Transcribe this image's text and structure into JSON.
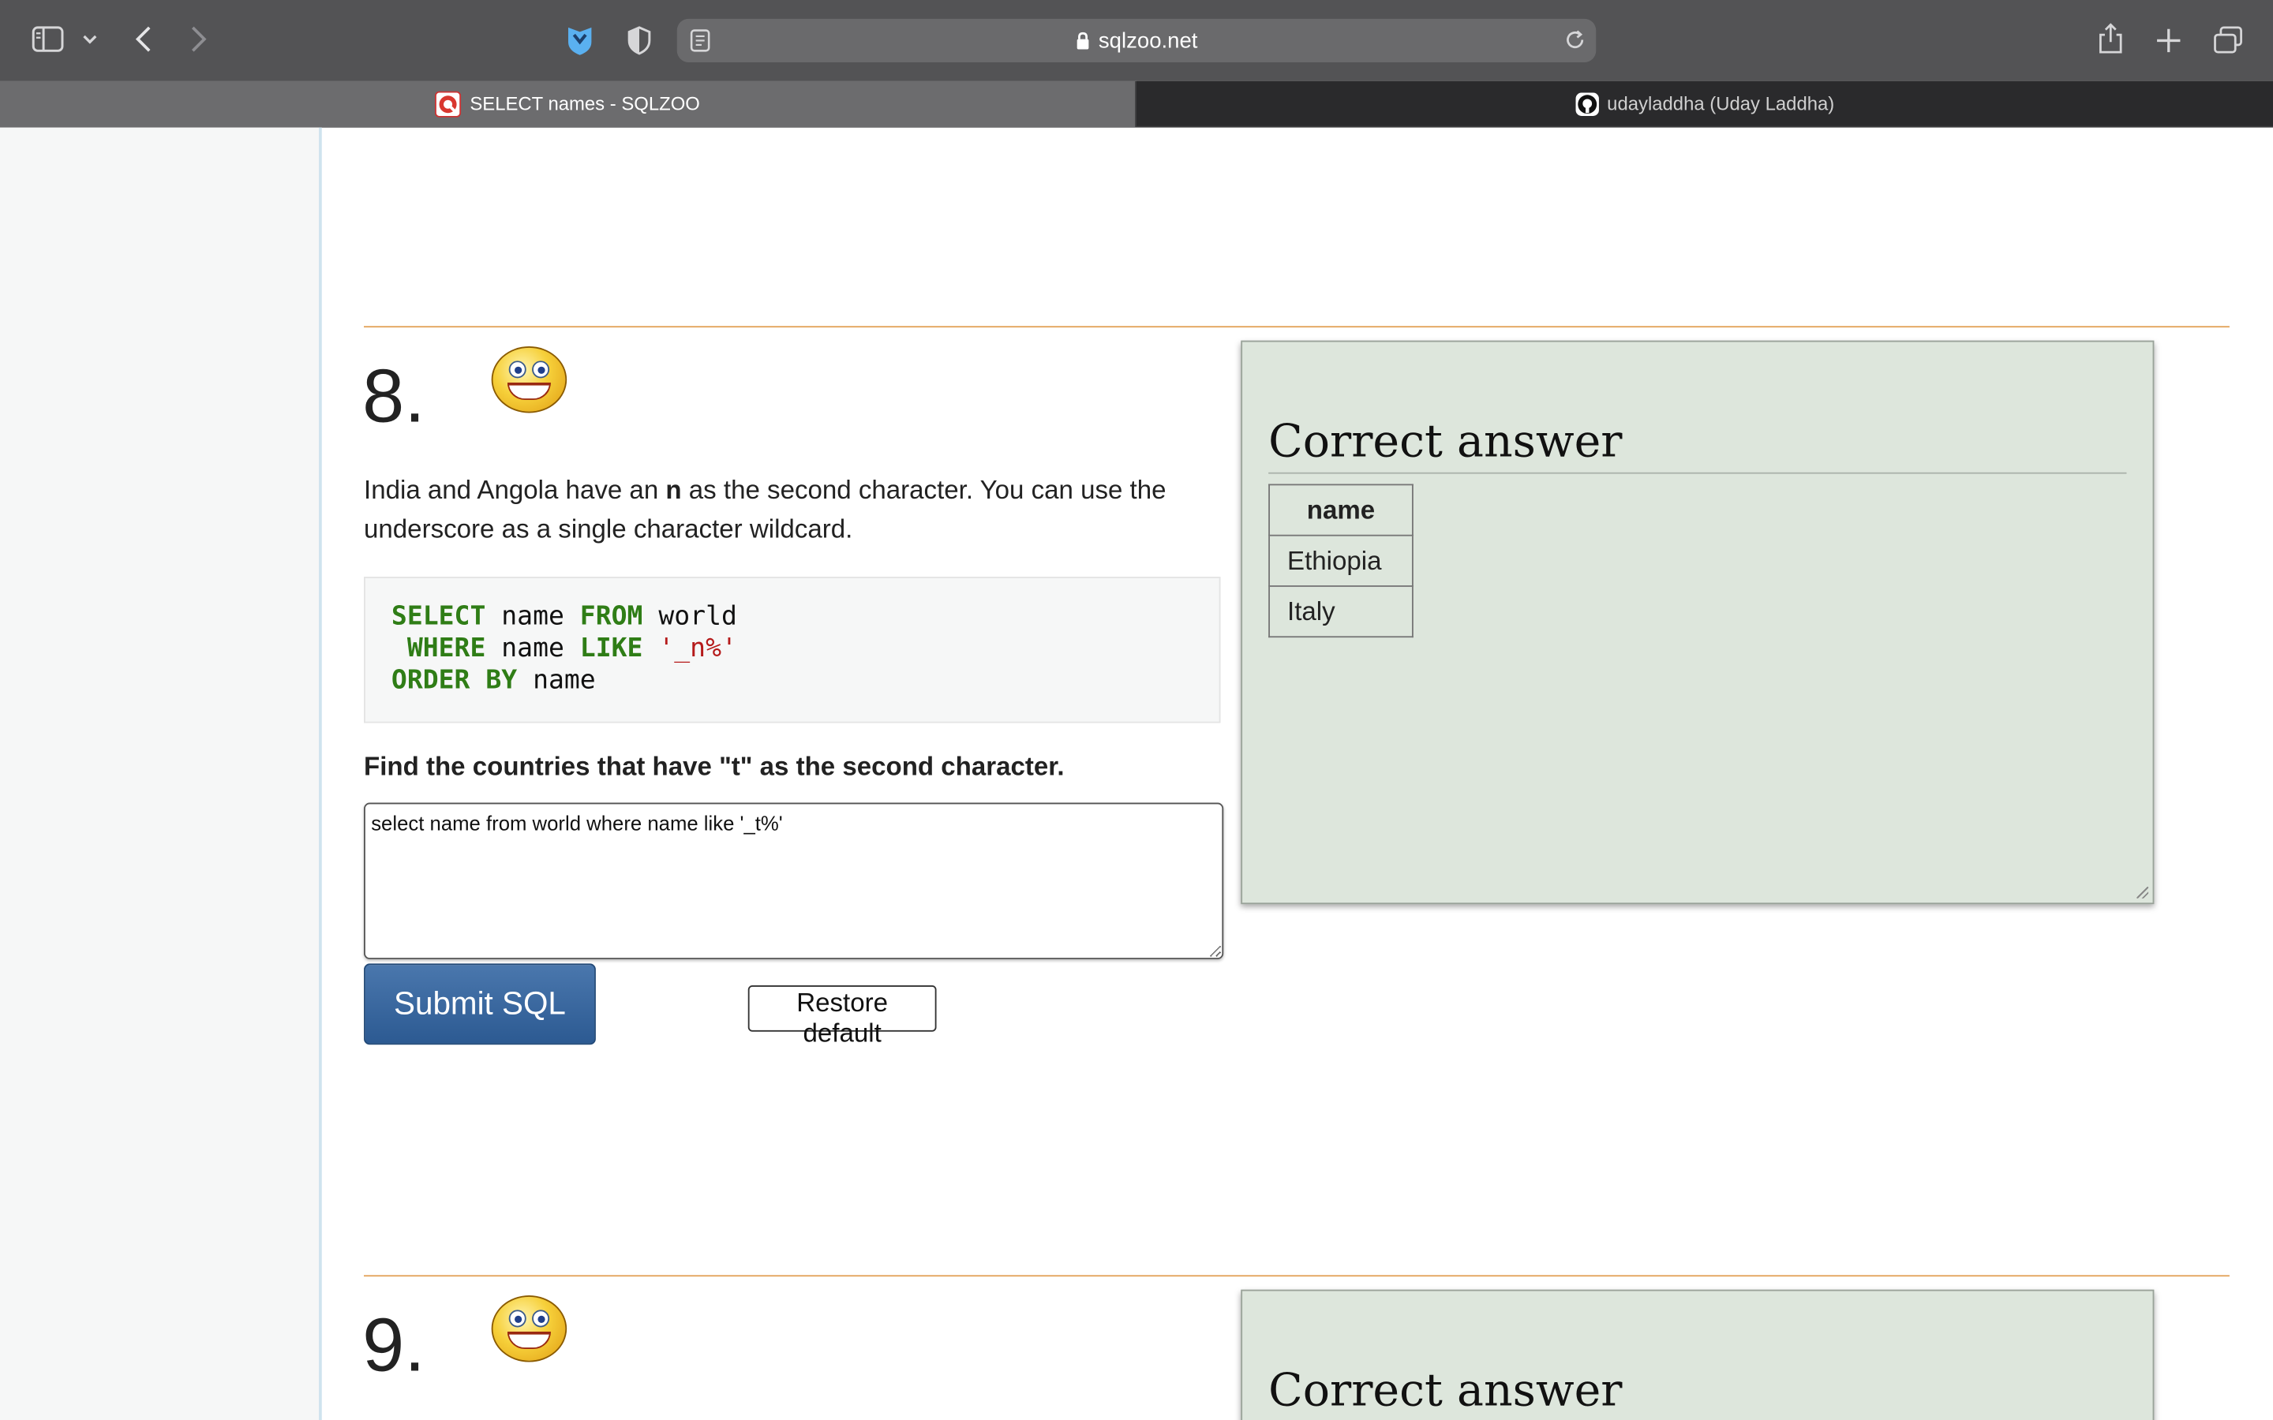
{
  "browser": {
    "url": "sqlzoo.net",
    "tabs": [
      {
        "title": "SELECT names - SQLZOO",
        "active": true,
        "favicon": "sqlzoo-favicon"
      },
      {
        "title": "udayladdha (Uday Laddha)",
        "active": false,
        "favicon": "github-favicon"
      }
    ],
    "icons": [
      "sidebar-icon",
      "chevron-down-icon",
      "back-icon",
      "forward-icon",
      "extension-shield-icon",
      "privacy-shield-icon",
      "reader-icon",
      "lock-icon",
      "reload-icon",
      "share-icon",
      "new-tab-icon",
      "tab-overview-icon"
    ]
  },
  "question8": {
    "number": "8.",
    "description_before": "India and Angola have an ",
    "description_bold": "n",
    "description_after": " as the second character. You can use the underscore as a single character wildcard.",
    "code": {
      "line1_kw1": "SELECT",
      "line1_id": " name ",
      "line1_kw2": "FROM",
      "line1_id2": " world",
      "line2_kw1": " WHERE",
      "line2_id": " name ",
      "line2_kw2": "LIKE",
      "line2_str": " '_n%'",
      "line3_kw": "ORDER BY",
      "line3_id": " name"
    },
    "task": "Find the countries that have \"t\" as the second character.",
    "input_value": "select name from world where name like '_t%'",
    "submit_label": "Submit SQL",
    "restore_label": "Restore default",
    "answer": {
      "title": "Correct answer",
      "column": "name",
      "rows": [
        "Ethiopia",
        "Italy"
      ]
    }
  },
  "question9": {
    "number": "9.",
    "answer_title": "Correct answer"
  },
  "colors": {
    "keyword": "#2f7d16",
    "string": "#b51a1a",
    "answer_panel": "#dde6dc",
    "submit_button": "#2c5a92",
    "rule": "#e3a35a"
  }
}
